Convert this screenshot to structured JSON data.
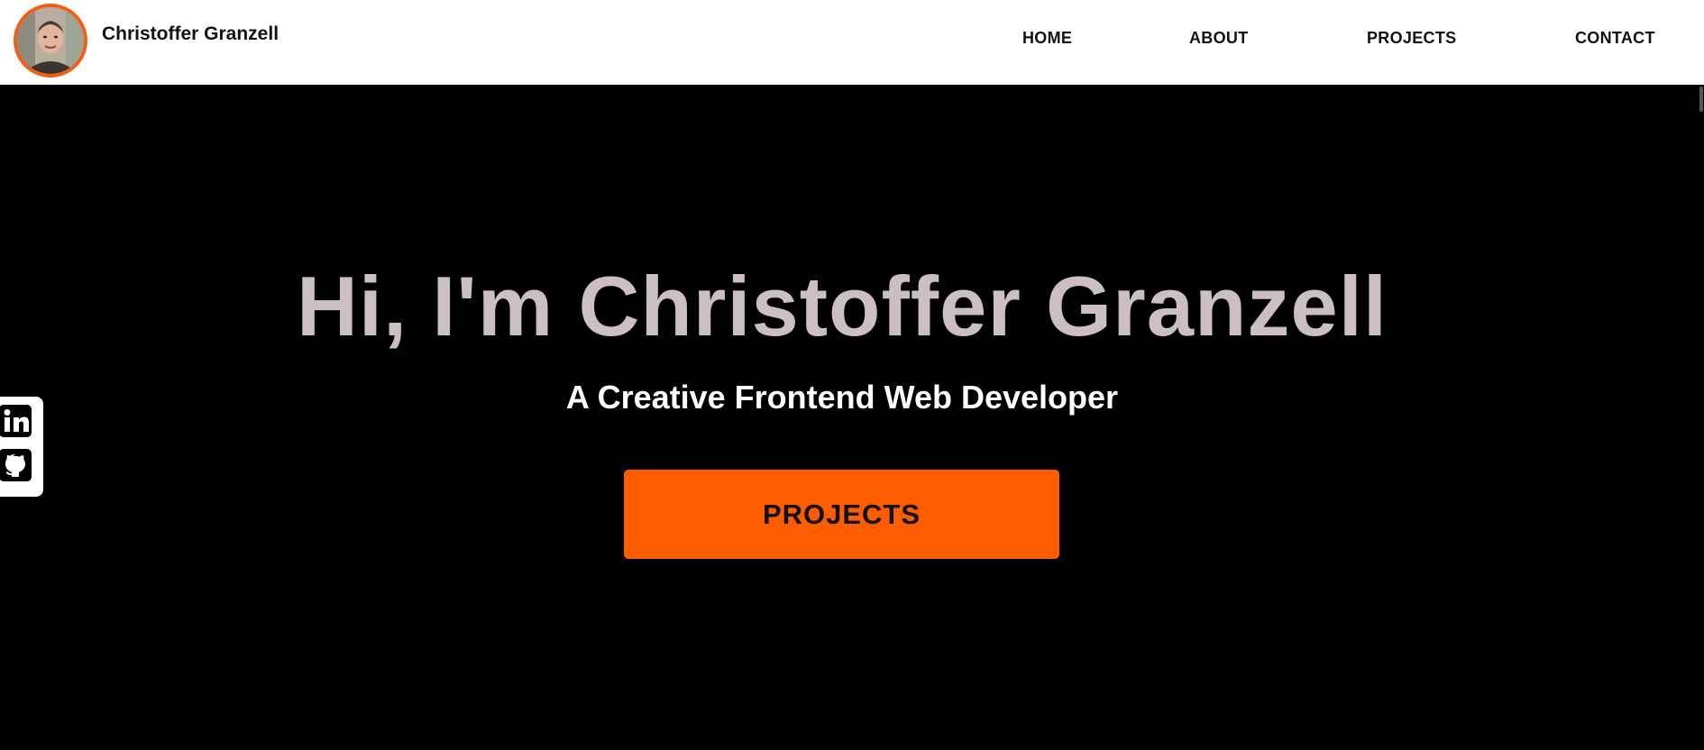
{
  "header": {
    "brand_name": "Christoffer Granzell",
    "avatar_icon": "profile-photo-avatar",
    "nav": {
      "home": "HOME",
      "about": "ABOUT",
      "projects": "PROJECTS",
      "contact": "CONTACT"
    }
  },
  "hero": {
    "title": "Hi, I'm Christoffer Granzell",
    "subtitle": "A Creative Frontend Web Developer",
    "cta_label": "PROJECTS"
  },
  "social": {
    "linkedin_icon": "linkedin-icon",
    "github_icon": "github-icon"
  },
  "colors": {
    "accent": "#fd5d00",
    "avatar_ring": "#f15f14",
    "hero_background": "#000000",
    "hero_title": "#cbbfc1",
    "header_background": "#ffffff"
  }
}
